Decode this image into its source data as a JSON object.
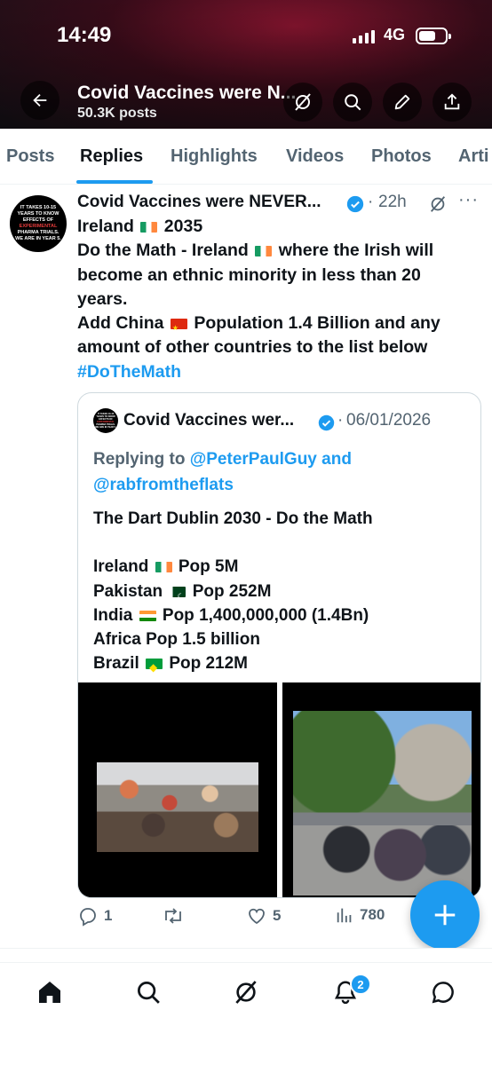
{
  "status_bar": {
    "time": "14:49",
    "network": "4G"
  },
  "header": {
    "title": "Covid Vaccines were N...",
    "post_count": "50.3K posts",
    "icons": [
      "back-arrow-icon",
      "grok-icon",
      "search-icon",
      "edit-pen-icon",
      "share-icon"
    ]
  },
  "tabs": [
    {
      "label": "Posts",
      "active": false
    },
    {
      "label": "Replies",
      "active": true
    },
    {
      "label": "Highlights",
      "active": false
    },
    {
      "label": "Videos",
      "active": false
    },
    {
      "label": "Photos",
      "active": false
    },
    {
      "label": "Arti",
      "active": false
    }
  ],
  "tweet": {
    "avatar_text": [
      "IT TAKES 10-15",
      "YEARS TO KNOW",
      "EFFECTS OF",
      "EXPERIMENTAL",
      "PHARMA TRIALS.",
      "WE ARE IN YEAR 5."
    ],
    "author": "Covid Vaccines were NEVER...",
    "dot": "·",
    "time": "22h",
    "more": "···",
    "lines": {
      "l1_pre": "Ireland",
      "l1_post": "2035",
      "l2_pre": "Do the Math - Ireland",
      "l2_post": "where the Irish will",
      "l3": "become an ethnic minority in less than 20",
      "l4": "years.",
      "l5_pre": "Add China",
      "l5_post": "Population 1.4 Billion and any",
      "l6": "amount of other countries to the list below",
      "hashtag": "#DoTheMath"
    },
    "quote": {
      "author": "Covid Vaccines wer...",
      "dot": "·",
      "date": "06/01/2026",
      "replying_to": "Replying to",
      "mention1": "@PeterPaulGuy",
      "and": "and",
      "mention2": "@rabfromtheflats",
      "title": "The Dart Dublin 2030 - Do the Math",
      "rows": {
        "ireland_pre": "Ireland",
        "ireland_post": "Pop 5M",
        "pakistan_pre": "Pakistan",
        "pakistan_post": "Pop 252M",
        "india_pre": "India",
        "india_post": "Pop 1,400,000,000 (1.4Bn)",
        "africa": "Africa Pop 1.5 billion",
        "brazil_pre": "Brazil",
        "brazil_post": "Pop 212M"
      }
    },
    "actions": {
      "replies": "1",
      "reposts": "",
      "likes": "5",
      "views": "780"
    }
  },
  "bottom_nav": {
    "items": [
      "home-icon",
      "search-icon",
      "grok-icon",
      "notifications-icon",
      "messages-icon"
    ],
    "notification_badge": "2"
  },
  "colors": {
    "accent": "#1d9bf0",
    "text": "#0f1419",
    "muted": "#536471",
    "border": "#cfd9de"
  }
}
